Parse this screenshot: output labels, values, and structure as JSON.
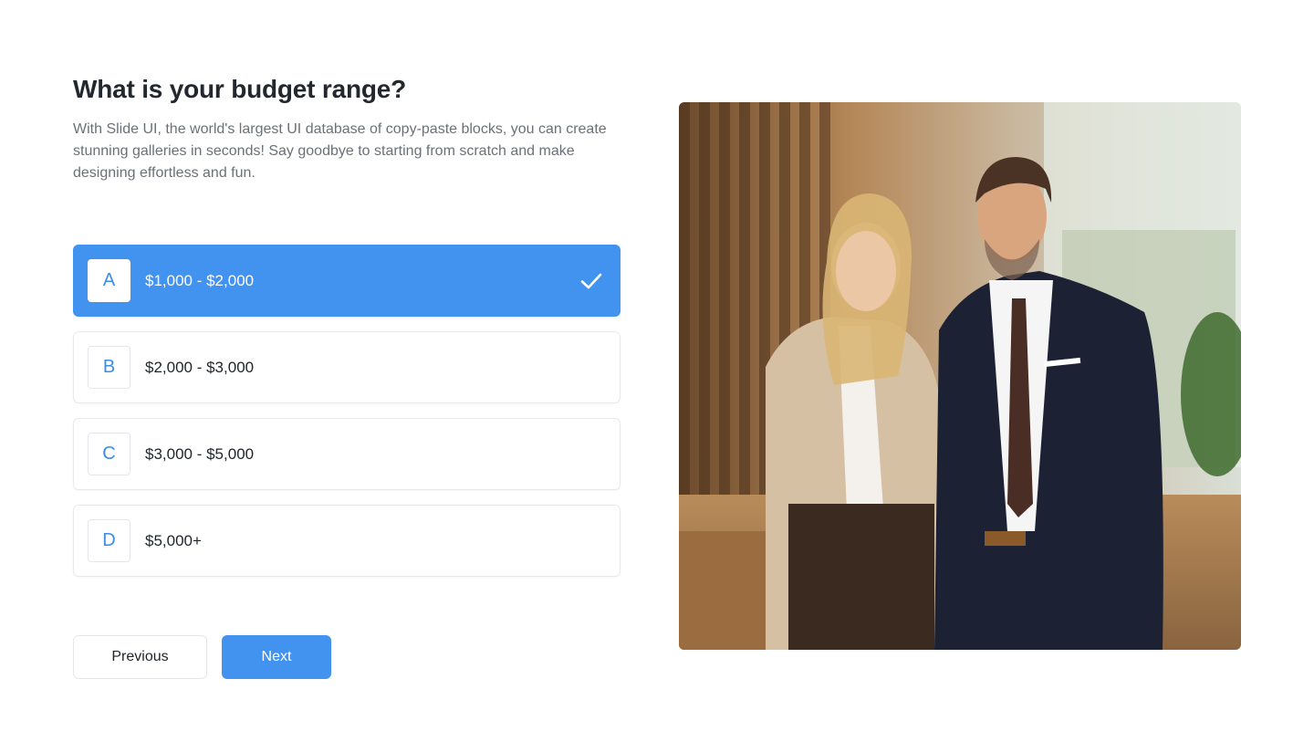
{
  "page": {
    "title": "What is your budget range?",
    "description": "With Slide UI, the world's largest UI database of copy-paste blocks, you can create stunning galleries in seconds! Say goodbye to starting from scratch and make designing effortless and fun."
  },
  "options": [
    {
      "letter": "A",
      "label": "$1,000 - $2,000",
      "selected": true
    },
    {
      "letter": "B",
      "label": "$2,000 - $3,000",
      "selected": false
    },
    {
      "letter": "C",
      "label": "$3,000 - $5,000",
      "selected": false
    },
    {
      "letter": "D",
      "label": "$5,000+",
      "selected": false
    }
  ],
  "buttons": {
    "previous": "Previous",
    "next": "Next"
  },
  "icons": {
    "selected_check": "check-icon"
  },
  "colors": {
    "accent": "#4292f0",
    "title": "#23272e",
    "body_text": "#6b7178"
  }
}
